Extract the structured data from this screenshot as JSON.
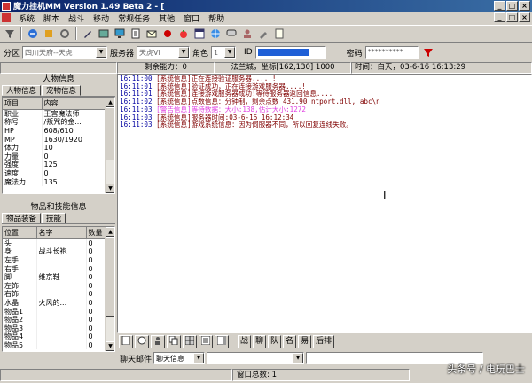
{
  "window": {
    "title": "魔力挂机MM Version 1.49 Beta 2 - [",
    "min": "_",
    "max": "□",
    "close": "×"
  },
  "menu": [
    "系统",
    "脚本",
    "战斗",
    "移动",
    "常规任务",
    "其他",
    "窗口",
    "帮助"
  ],
  "toolbar_icons": [
    "filter-icon",
    "connect-icon",
    "disconnect-icon",
    "settings-icon",
    "pen-icon",
    "image-icon",
    "monitor-icon",
    "script-icon",
    "mail-icon",
    "record-icon",
    "tomato-icon",
    "window-icon",
    "globe-icon",
    "chat-icon",
    "user-icon",
    "brush-icon",
    "note-icon"
  ],
  "login": {
    "area_label": "分区",
    "area_value": "四川天府--天虎",
    "server_label": "服务器",
    "server_value": "天虎VI",
    "role_label": "角色",
    "role_value": "1",
    "id_label": "ID",
    "password_label": "密码",
    "password_value": "**********"
  },
  "status_strip": {
    "remaining": "剩余能力：0",
    "location": "法兰城，坐标[162,130] 1000",
    "time": "时间：白天，03-6-16  16:13:29"
  },
  "char_panel": {
    "header": "人物信息",
    "tabs": [
      "人物信息",
      "宠物信息"
    ],
    "columns": [
      "项目",
      "内容"
    ],
    "rows": [
      [
        "职业",
        "王宫魔法师"
      ],
      [
        "称号",
        "/叛咒的金..."
      ],
      [
        "HP",
        "608/610"
      ],
      [
        "MP",
        "1630/1920"
      ],
      [
        "体力",
        "10"
      ],
      [
        "力量",
        "0"
      ],
      [
        "强度",
        "125"
      ],
      [
        "速度",
        "0"
      ],
      [
        "魔法力",
        "135"
      ]
    ]
  },
  "item_panel": {
    "header": "物品和技能信息",
    "tabs": [
      "物品装备",
      "技能"
    ],
    "columns": [
      "位置",
      "名字",
      "数量"
    ],
    "rows": [
      [
        "头",
        "",
        "0"
      ],
      [
        "身",
        "战斗长袍",
        "0"
      ],
      [
        "左手",
        "",
        "0"
      ],
      [
        "右手",
        "",
        "0"
      ],
      [
        "脚",
        "维京鞋",
        "0"
      ],
      [
        "左饰",
        "",
        "0"
      ],
      [
        "右饰",
        "",
        "0"
      ],
      [
        "水晶",
        "火风的...",
        "0"
      ],
      [
        "物品1",
        "",
        "0"
      ],
      [
        "物品2",
        "",
        "0"
      ],
      [
        "物品3",
        "",
        "0"
      ],
      [
        "物品4",
        "",
        "0"
      ],
      [
        "物品5",
        "",
        "0"
      ]
    ]
  },
  "log": [
    {
      "ts": "16:11:00",
      "msg": "[系统信息]正在连接验证服务器.....!",
      "style": "normal"
    },
    {
      "ts": "16:11:01",
      "msg": "[系统信息]验证成功，正在连接游戏服务器....!",
      "style": "normal"
    },
    {
      "ts": "16:11:01",
      "msg": "[系统信息]连接游戏服务器成功!等待服务器返回信息....",
      "style": "normal"
    },
    {
      "ts": "16:11:02",
      "msg": "[系统信息]点数信息：分钟制，剩余点数 431.90|ntport.dll, abc\\n",
      "style": "normal"
    },
    {
      "ts": "16:11:03",
      "msg": "[警告信息]等待数据：大小:138,估计大小:1272",
      "style": "magenta"
    },
    {
      "ts": "16:11:03",
      "msg": "[系统信息]服务器时间:03-6-16 16:12:34",
      "style": "normal"
    },
    {
      "ts": "16:11:03",
      "msg": "[系统信息]游戏系统信息：因为伺服器不同，所以回复连线失败。",
      "style": "normal"
    }
  ],
  "bottom_buttons": [
    "战",
    "聊",
    "队",
    "名",
    "易",
    "后排"
  ],
  "chat": {
    "label": "聊天邮件",
    "channel": "聊天信息"
  },
  "statusbar": {
    "window_count": "窗口总数: 1"
  },
  "watermark": "头条号 / 电玩巴士"
}
